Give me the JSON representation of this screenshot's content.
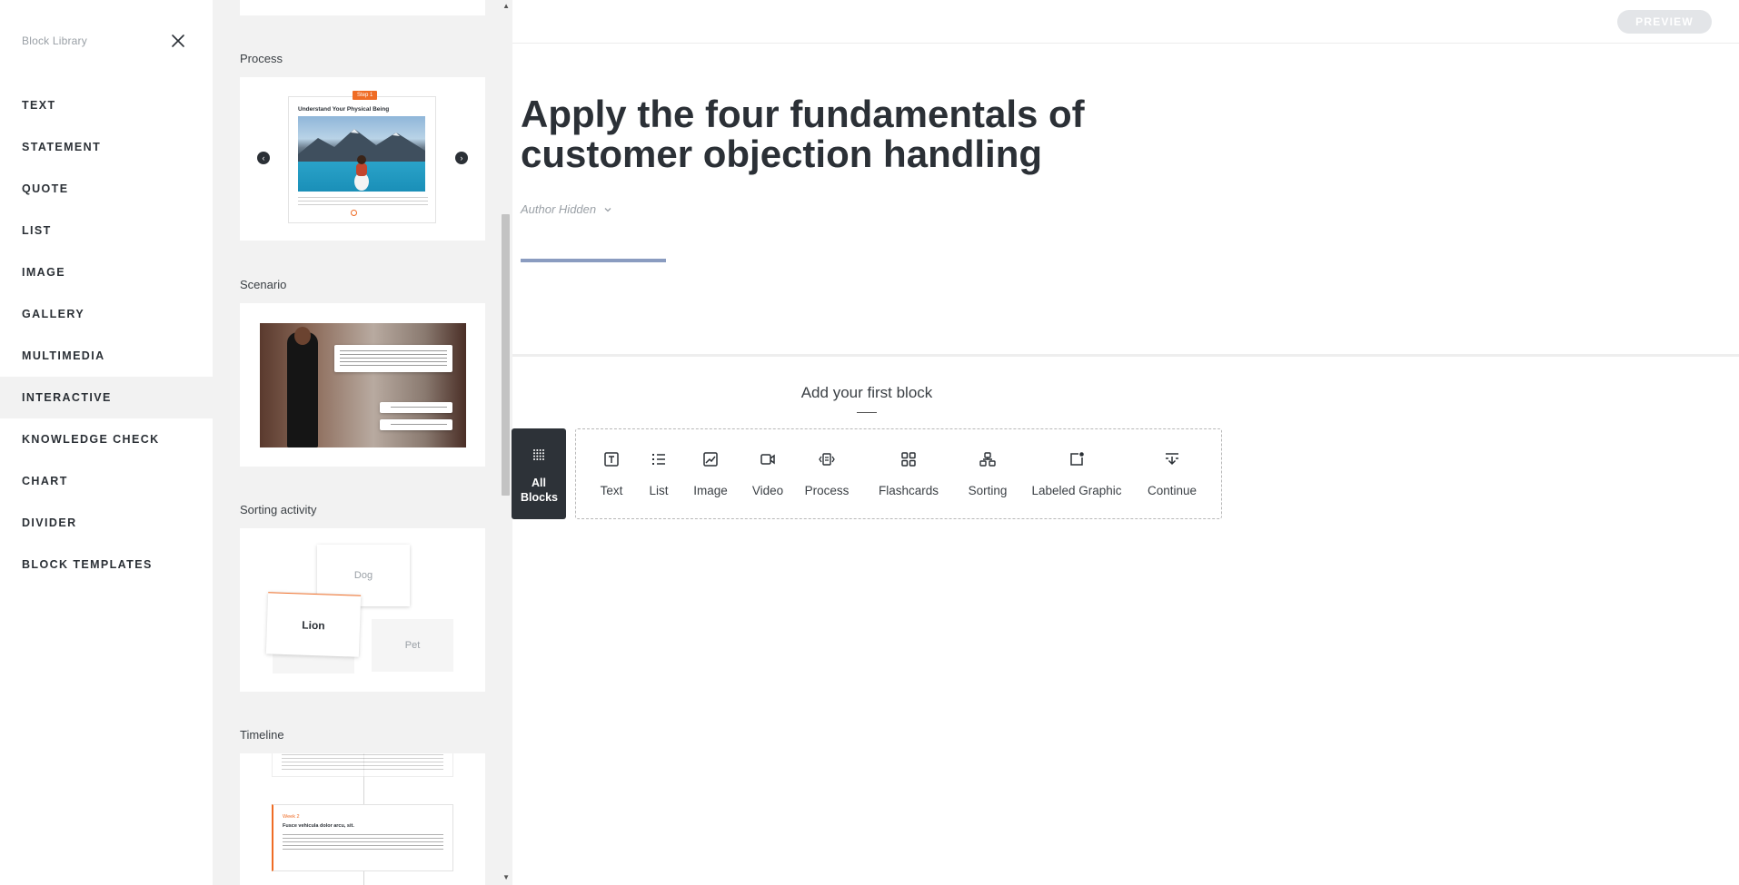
{
  "sidebar": {
    "title": "Block Library",
    "categories": [
      {
        "label": "TEXT"
      },
      {
        "label": "STATEMENT"
      },
      {
        "label": "QUOTE"
      },
      {
        "label": "LIST"
      },
      {
        "label": "IMAGE"
      },
      {
        "label": "GALLERY"
      },
      {
        "label": "MULTIMEDIA"
      },
      {
        "label": "INTERACTIVE",
        "active": true
      },
      {
        "label": "KNOWLEDGE CHECK"
      },
      {
        "label": "CHART"
      },
      {
        "label": "DIVIDER"
      },
      {
        "label": "BLOCK TEMPLATES"
      }
    ]
  },
  "panel": {
    "sections": [
      {
        "label": "Process",
        "step_badge": "Step 1",
        "card_title": "Understand Your Physical Being"
      },
      {
        "label": "Scenario"
      },
      {
        "label": "Sorting activity",
        "cards": [
          "Dog",
          "Lion",
          "Pet"
        ]
      },
      {
        "label": "Timeline",
        "entry_title": "Week 2",
        "entry_heading": "Fusce vehicula dolor arcu, sit."
      }
    ]
  },
  "main": {
    "preview_label": "PREVIEW",
    "lesson_title": "Apply the four fundamentals of customer objection handling",
    "author_label": "Author Hidden",
    "progress": 0.12,
    "add_first_block": "Add your first block",
    "all_blocks_label": "All Blocks",
    "quick_blocks": [
      {
        "label": "Text",
        "icon": "text-icon"
      },
      {
        "label": "List",
        "icon": "list-icon"
      },
      {
        "label": "Image",
        "icon": "image-icon"
      },
      {
        "label": "Video",
        "icon": "video-icon"
      },
      {
        "label": "Process",
        "icon": "process-icon"
      },
      {
        "label": "Flashcards",
        "icon": "flashcards-icon"
      },
      {
        "label": "Sorting",
        "icon": "sorting-icon"
      },
      {
        "label": "Labeled Graphic",
        "icon": "labeled-graphic-icon"
      },
      {
        "label": "Continue",
        "icon": "continue-icon"
      }
    ]
  },
  "colors": {
    "accent_orange": "#ef6c25",
    "dark": "#2d3238",
    "progress": "#8a9cc0",
    "panel_bg": "#f2f2f2"
  }
}
